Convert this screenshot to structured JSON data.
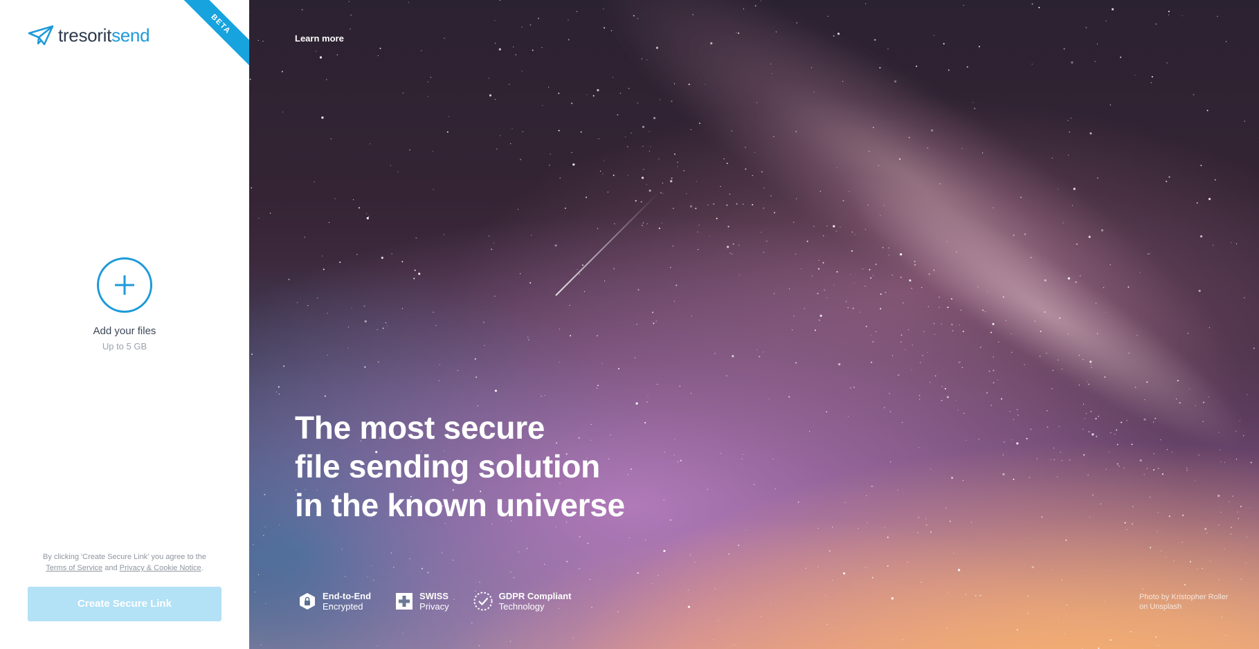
{
  "sidebar": {
    "logo": {
      "brand": "tresorit",
      "product": "send"
    },
    "beta_label": "BETA",
    "add_files": {
      "title": "Add your files",
      "subtitle": "Up to 5 GB"
    },
    "consent": {
      "prefix": "By clicking 'Create Secure Link' you agree to the",
      "terms_link": "Terms of Service",
      "and": "and",
      "privacy_link": "Privacy & Cookie Notice",
      "suffix": "."
    },
    "create_button": "Create Secure Link"
  },
  "hero": {
    "learn_more": "Learn more",
    "headline": [
      "The most secure",
      "file sending solution",
      "in the known universe"
    ],
    "features": [
      {
        "icon": "shield-lock-icon",
        "title": "End-to-End",
        "subtitle": "Encrypted"
      },
      {
        "icon": "swiss-cross-icon",
        "title": "SWISS",
        "subtitle": "Privacy"
      },
      {
        "icon": "gdpr-badge-icon",
        "title": "GDPR Compliant",
        "subtitle": "Technology"
      }
    ],
    "photo_credit": {
      "line1": "Photo by Kristopher Roller",
      "line2": "on Unsplash"
    }
  },
  "colors": {
    "accent": "#1d9ad9",
    "button_disabled": "#b3e1f5",
    "logo_dark": "#2e3a4c"
  }
}
